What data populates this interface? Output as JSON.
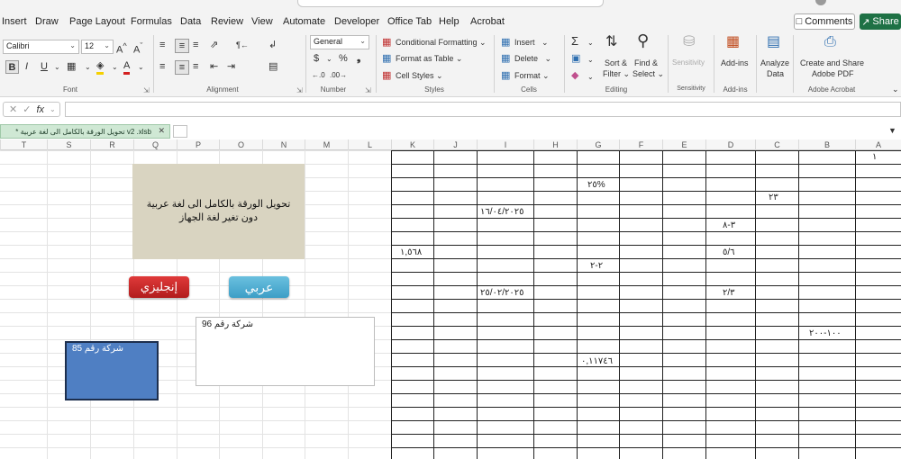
{
  "menu": {
    "tabs": [
      "Insert",
      "Draw",
      "Page Layout",
      "Formulas",
      "Data",
      "Review",
      "View",
      "Automate",
      "Developer",
      "Office Tab",
      "Help",
      "Acrobat"
    ],
    "comments_label": "Comments",
    "share_label": "Share"
  },
  "ribbon": {
    "font": {
      "name": "Calibri",
      "size": "12",
      "group_label": "Font"
    },
    "alignment": {
      "group_label": "Alignment"
    },
    "number": {
      "format": "General",
      "group_label": "Number"
    },
    "styles": {
      "conditional_formatting": "Conditional Formatting",
      "format_as_table": "Format as Table",
      "cell_styles": "Cell Styles",
      "group_label": "Styles"
    },
    "cells": {
      "insert": "Insert",
      "delete": "Delete",
      "format": "Format",
      "group_label": "Cells"
    },
    "editing": {
      "sort_filter_1": "Sort &",
      "sort_filter_2": "Filter",
      "find_select_1": "Find &",
      "find_select_2": "Select",
      "group_label": "Editing"
    },
    "sensitivity": {
      "label": "Sensitivity",
      "group_label": "Sensitivity"
    },
    "addins": {
      "label": "Add-ins",
      "group_label": "Add-ins"
    },
    "analyze": {
      "label_1": "Analyze",
      "label_2": "Data"
    },
    "acrobat": {
      "label_1": "Create and Share",
      "label_2": "Adobe PDF",
      "group_label": "Adobe Acrobat"
    }
  },
  "formula_bar": {
    "fx": "fx",
    "value": ""
  },
  "document": {
    "tab_title": "* تحويل الورقة بالكامل الى لغة عربية v2 .xlsb"
  },
  "columns": [
    "T",
    "S",
    "R",
    "Q",
    "P",
    "O",
    "N",
    "M",
    "L",
    "K",
    "J",
    "I",
    "H",
    "G",
    "F",
    "E",
    "D",
    "C",
    "B",
    "A"
  ],
  "row_numbers": {
    "first": "١"
  },
  "cells": {
    "g_pct": "٢٥%",
    "c_num": "٢٣",
    "i_date1": "١٦/٠٤/٢٠٢٥",
    "d_range": "٣-٨",
    "k_num": "١,٥٦٨",
    "d_frac": "٥/٦",
    "g_range": "٢-٢",
    "i_date2": "٢٥/٠٢/٢٠٢٥",
    "d_frac2": "٢/٣",
    "b_range": "١٠٠-٢٠٠",
    "g_decimal": "٠,١١٧٤٦"
  },
  "shapes": {
    "title_line1": "تحويل الورقة بالكامل الى لغة عربية",
    "title_line2": "دون تغير لغة الجهاز",
    "arabic_button": "عربي",
    "english_button": "إنجليزي",
    "textbox_96": "شركة رقم 96",
    "textbox_85": "شركة رقم 85"
  },
  "colors": {
    "share_green": "#1e7145",
    "arabic_button": "#3c9ec6",
    "english_button": "#b11c1c",
    "title_shape": "#d9d4c1",
    "box_85": "#4f7fc3"
  }
}
